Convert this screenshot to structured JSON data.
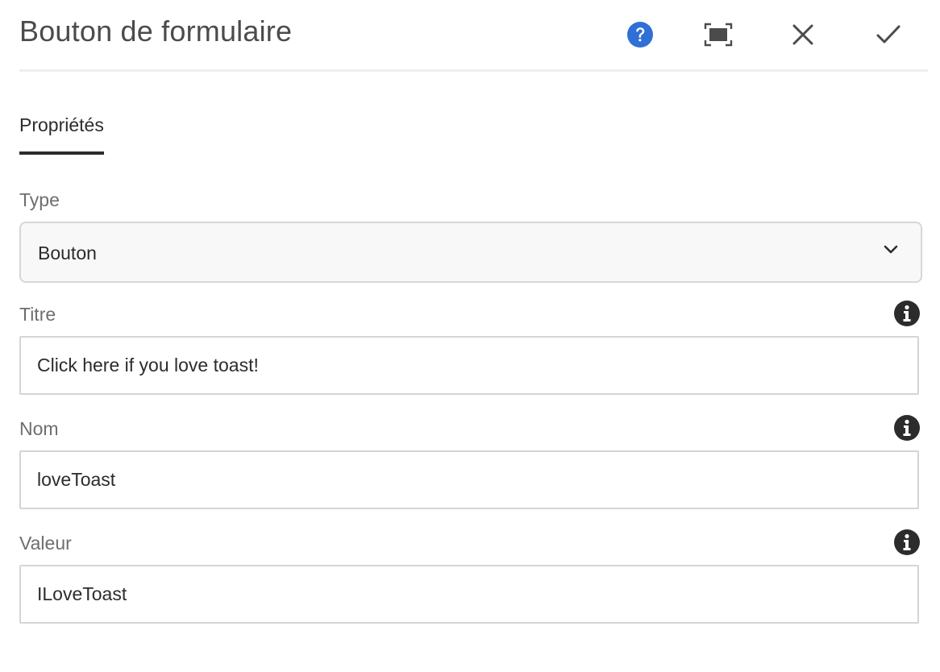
{
  "dialog": {
    "title": "Bouton de formulaire",
    "actions": {
      "help": "question-circle-icon",
      "fullscreen": "fullscreen-icon",
      "close": "close-icon",
      "done": "checkmark-icon"
    },
    "accent_color": "#2f6fd6"
  },
  "tabs": [
    {
      "label": "Propriétés",
      "selected": true
    }
  ],
  "form": {
    "type": {
      "label": "Type",
      "selected_value": "Bouton",
      "icon": "chevron-down-icon"
    },
    "title": {
      "label": "Titre",
      "value": "Click here if you love toast!",
      "info_icon": "info-icon"
    },
    "name": {
      "label": "Nom",
      "value": "loveToast",
      "info_icon": "info-icon"
    },
    "value": {
      "label": "Valeur",
      "value": "ILoveToast",
      "info_icon": "info-icon"
    }
  }
}
